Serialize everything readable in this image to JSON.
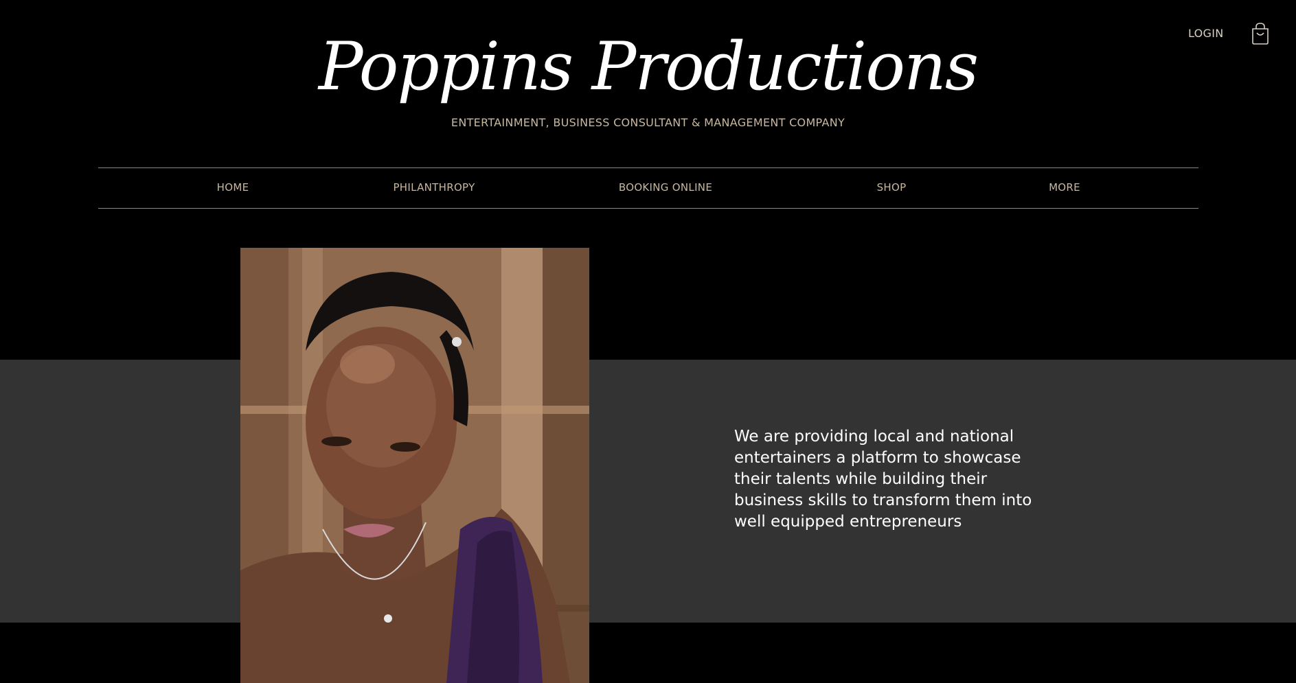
{
  "header": {
    "login_label": "LOGIN",
    "cart_icon": "shopping-bag-icon",
    "title": "Poppins Productions",
    "subtitle": "ENTERTAINMENT, BUSINESS CONSULTANT & MANAGEMENT COMPANY"
  },
  "nav": {
    "items": [
      {
        "label": "HOME"
      },
      {
        "label": "PHILANTHROPY"
      },
      {
        "label": "BOOKING ONLINE"
      },
      {
        "label": "SHOP"
      },
      {
        "label": "MORE"
      }
    ]
  },
  "hero": {
    "photo_icon": "portrait-photo",
    "mission": "We are providing local and national entertainers a platform to showcase their talents while building their business skills to transform them into well equipped entrepreneurs"
  },
  "colors": {
    "background": "#000000",
    "band": "#333333",
    "nav_text": "#c9b8a0",
    "nav_border": "#8a8a8a",
    "title": "#ffffff"
  }
}
